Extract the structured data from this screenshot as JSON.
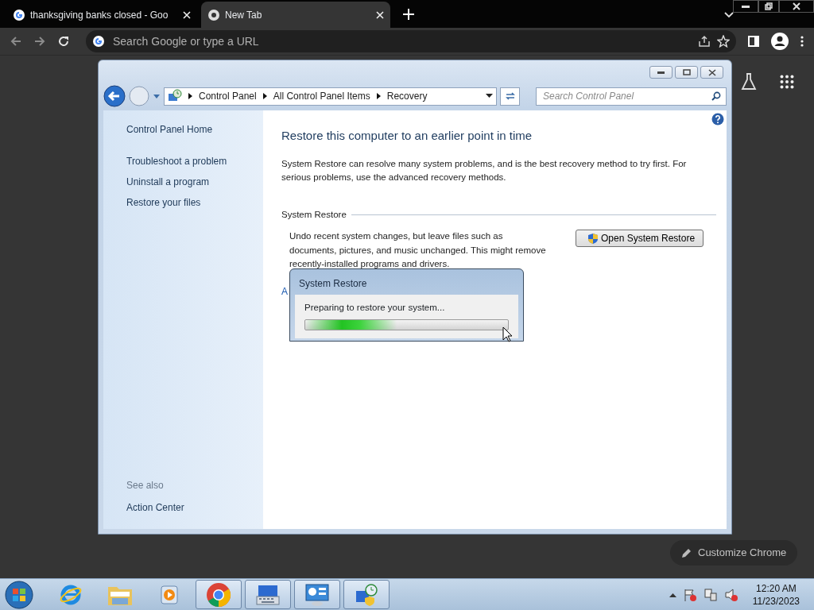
{
  "browser": {
    "tabs": [
      {
        "title": "thanksgiving banks closed - Goo",
        "selected": false
      },
      {
        "title": "New Tab",
        "selected": true
      }
    ],
    "address": {
      "placeholder": "Search Google or type a URL"
    },
    "customize_button": "Customize Chrome"
  },
  "control_panel": {
    "breadcrumb": [
      "Control Panel",
      "All Control Panel Items",
      "Recovery"
    ],
    "search": {
      "placeholder": "Search Control Panel"
    },
    "sidebar": {
      "home": "Control Panel Home",
      "links": [
        "Troubleshoot a problem",
        "Uninstall a program",
        "Restore your files"
      ],
      "see_also_label": "See also",
      "see_also_links": [
        "Action Center"
      ]
    },
    "heading": "Restore this computer to an earlier point in time",
    "intro": "System Restore can resolve many system problems, and is the best recovery method to try first. For serious problems, use the advanced recovery methods.",
    "section_title": "System Restore",
    "section_text": "Undo recent system changes, but leave files such as documents, pictures, and music unchanged. This might remove recently-installed programs and drivers.",
    "button": "Open System Restore",
    "covered_link": "A"
  },
  "dialog": {
    "title": "System Restore",
    "message": "Preparing to restore your system...",
    "progress": {
      "level": 0.45
    }
  },
  "taskbar": {
    "items": [
      {
        "kind": "ie",
        "open": false
      },
      {
        "kind": "folder",
        "open": false
      },
      {
        "kind": "media",
        "open": false
      },
      {
        "kind": "chrome",
        "open": true
      },
      {
        "kind": "keyboard",
        "open": true
      },
      {
        "kind": "panel",
        "open": true
      },
      {
        "kind": "recovery",
        "open": true
      }
    ],
    "time": "12:20 AM",
    "date": "11/23/2023"
  }
}
